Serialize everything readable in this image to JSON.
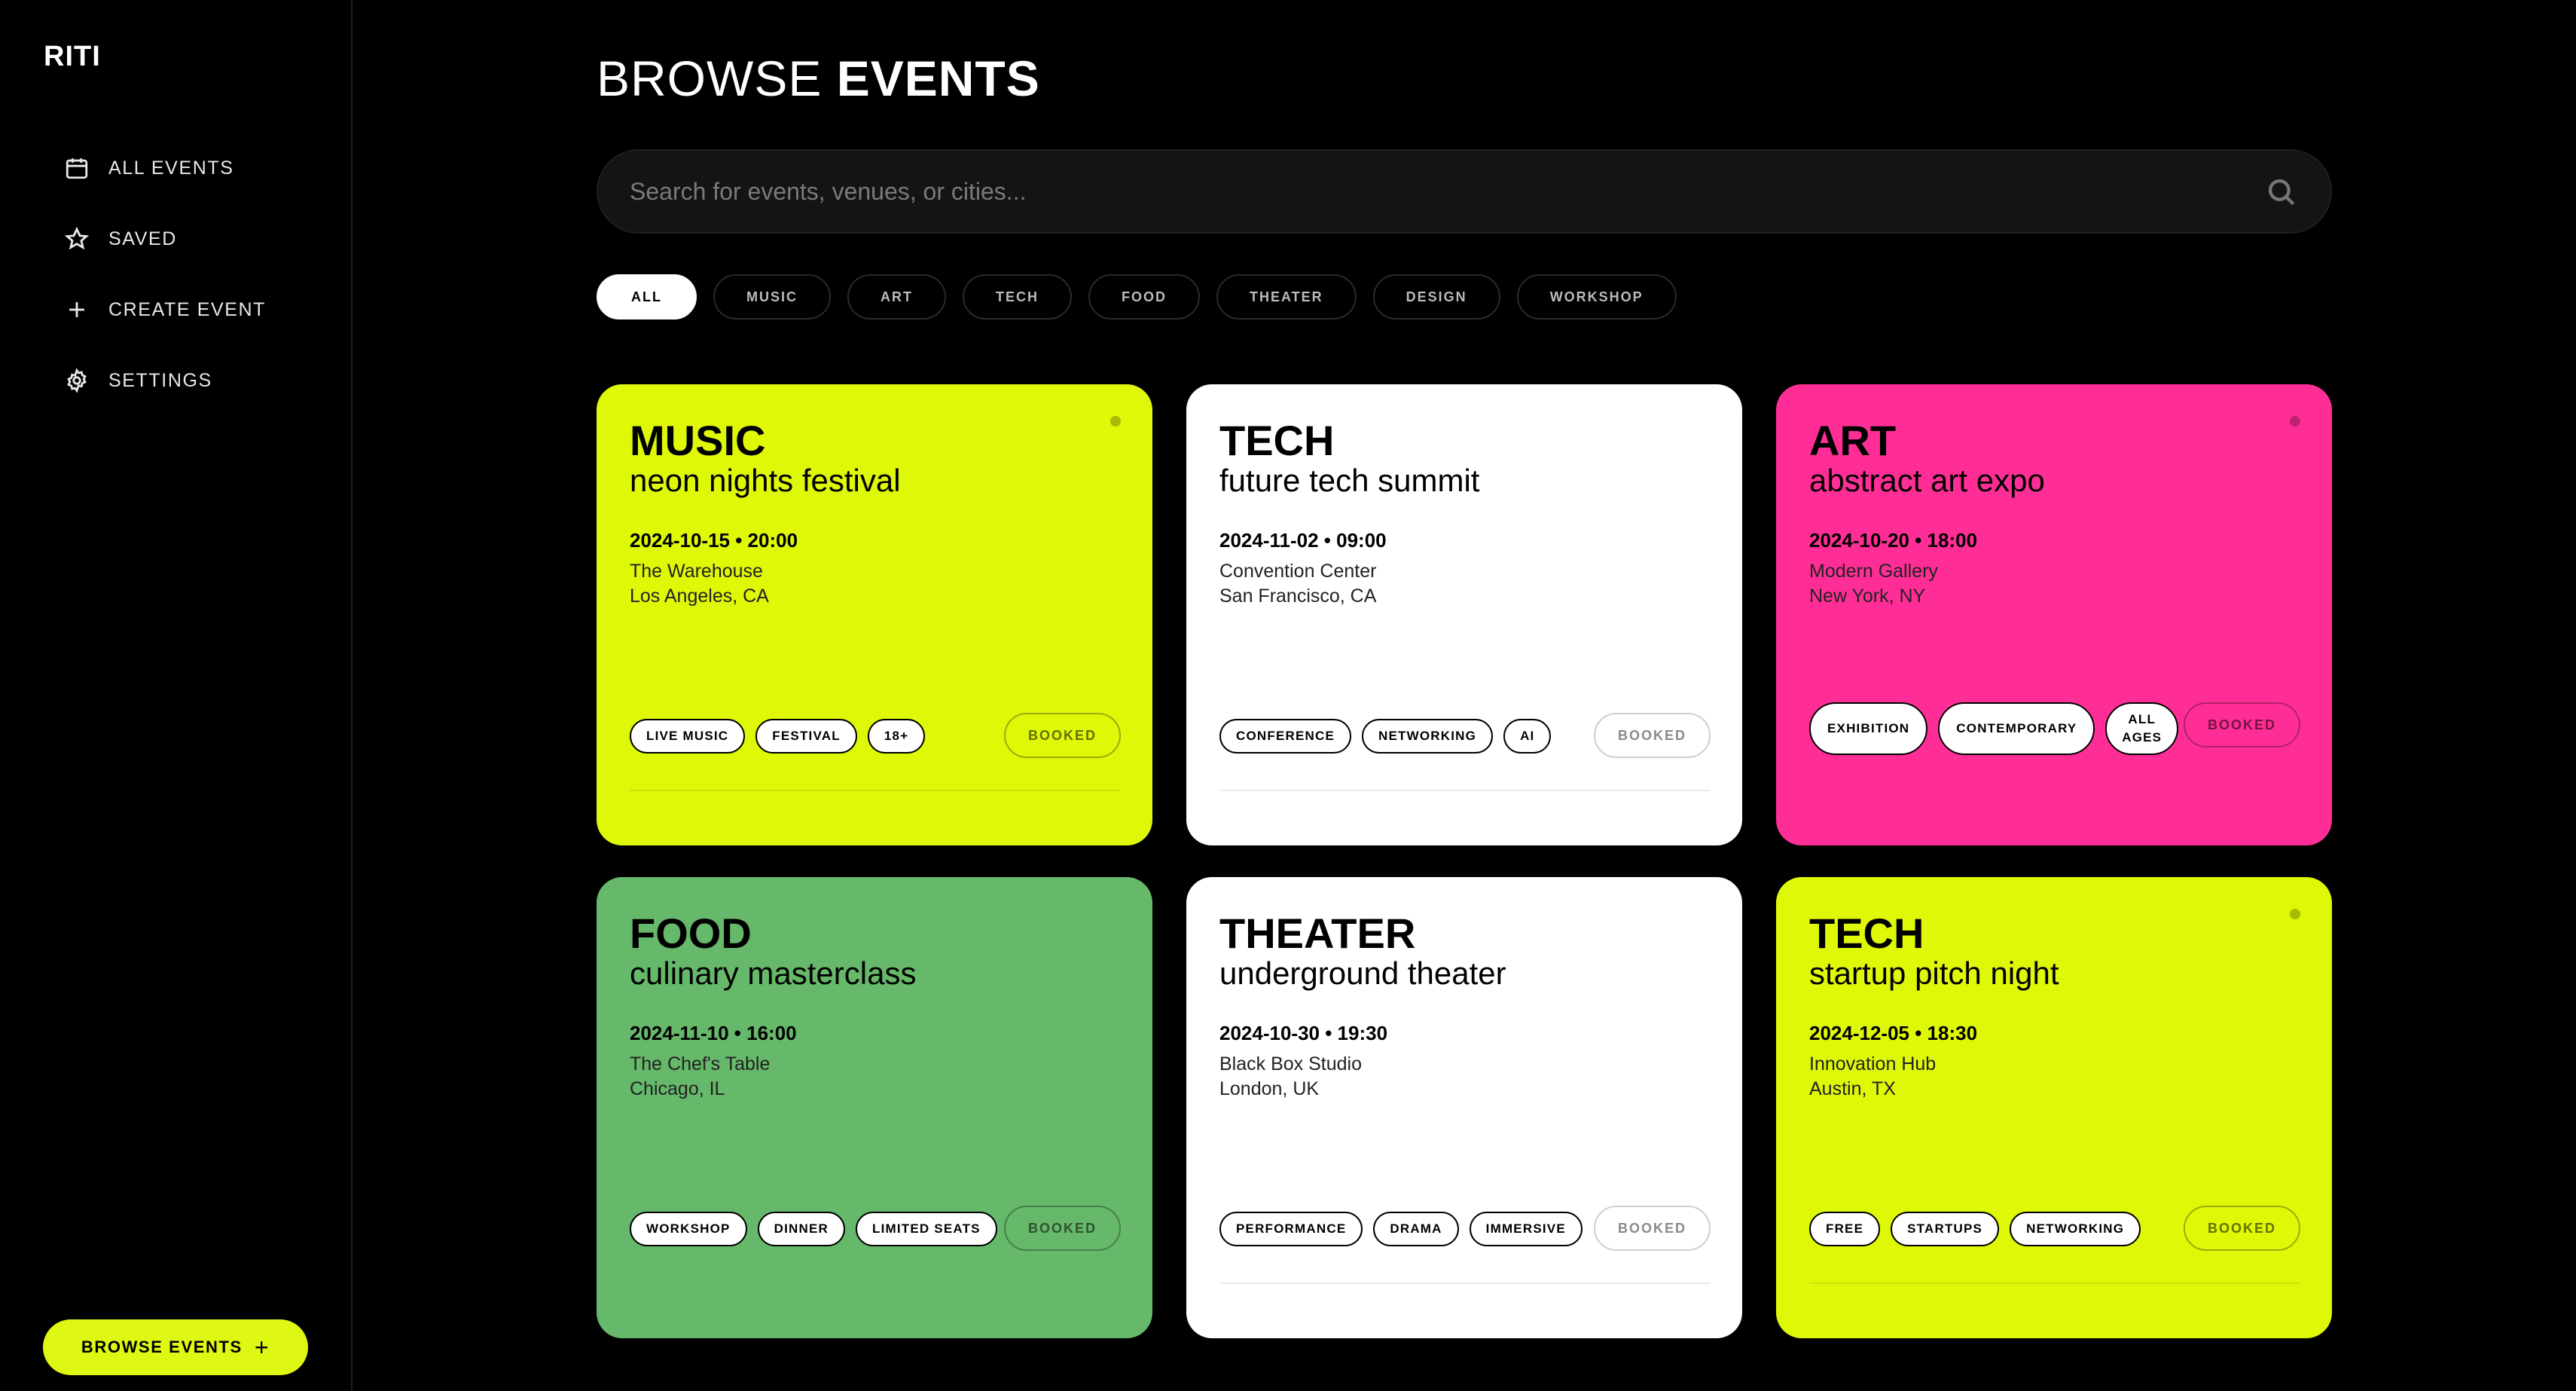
{
  "sidebar": {
    "logo": "RITI",
    "nav": [
      {
        "label": "ALL EVENTS",
        "icon": "calendar-icon"
      },
      {
        "label": "SAVED",
        "icon": "star-icon"
      },
      {
        "label": "CREATE EVENT",
        "icon": "plus-icon"
      },
      {
        "label": "SETTINGS",
        "icon": "gear-icon"
      }
    ],
    "browse_button": "BROWSE EVENTS"
  },
  "main": {
    "title_light": "BROWSE ",
    "title_bold": "EVENTS",
    "search_placeholder": "Search for events, venues, or cities...",
    "filters": [
      "ALL",
      "MUSIC",
      "ART",
      "TECH",
      "FOOD",
      "THEATER",
      "DESIGN",
      "WORKSHOP"
    ],
    "active_filter": "ALL",
    "booked_label": "BOOKED"
  },
  "events": [
    {
      "category": "MUSIC",
      "name": "neon nights festival",
      "datetime": "2024-10-15 • 20:00",
      "venue": "The Warehouse",
      "city": "Los Angeles, CA",
      "color": "#def808",
      "tags": [
        "LIVE MUSIC",
        "FESTIVAL",
        "18+"
      ]
    },
    {
      "category": "TECH",
      "name": "future tech summit",
      "datetime": "2024-11-02 • 09:00",
      "venue": "Convention Center",
      "city": "San Francisco, CA",
      "color": "#ffffff",
      "tags": [
        "CONFERENCE",
        "NETWORKING",
        "AI"
      ]
    },
    {
      "category": "ART",
      "name": "abstract art expo",
      "datetime": "2024-10-20 • 18:00",
      "venue": "Modern Gallery",
      "city": "New York, NY",
      "color": "#ff2e96",
      "tags": [
        "EXHIBITION",
        "CONTEMPORARY",
        "ALL AGES"
      ]
    },
    {
      "category": "FOOD",
      "name": "culinary masterclass",
      "datetime": "2024-11-10 • 16:00",
      "venue": "The Chef's Table",
      "city": "Chicago, IL",
      "color": "#66b86a",
      "tags": [
        "WORKSHOP",
        "DINNER",
        "LIMITED SEATS"
      ]
    },
    {
      "category": "THEATER",
      "name": "underground theater",
      "datetime": "2024-10-30 • 19:30",
      "venue": "Black Box Studio",
      "city": "London, UK",
      "color": "#ffffff",
      "tags": [
        "PERFORMANCE",
        "DRAMA",
        "IMMERSIVE"
      ]
    },
    {
      "category": "TECH",
      "name": "startup pitch night",
      "datetime": "2024-12-05 • 18:30",
      "venue": "Innovation Hub",
      "city": "Austin, TX",
      "color": "#def808",
      "tags": [
        "FREE",
        "STARTUPS",
        "NETWORKING"
      ]
    }
  ]
}
